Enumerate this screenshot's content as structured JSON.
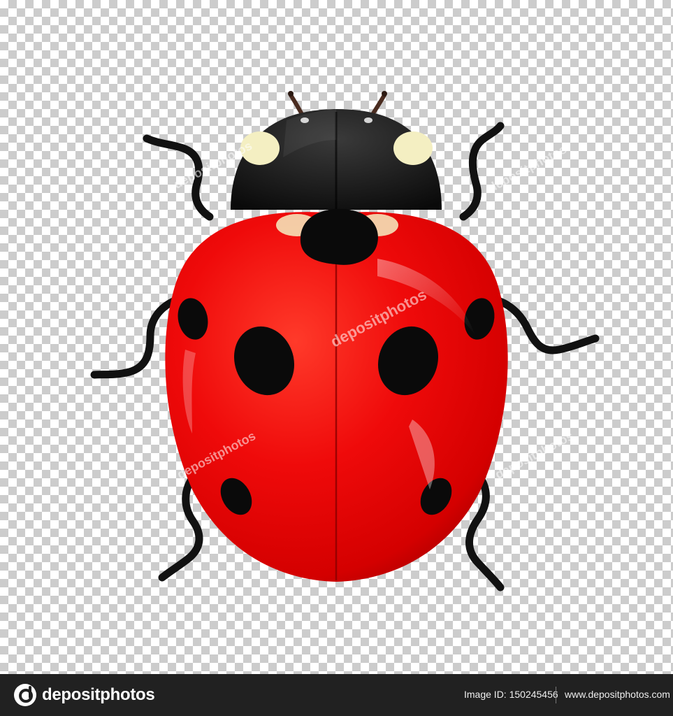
{
  "footer": {
    "logo_text": "depositphotos",
    "image_id": "Image ID: 150245456",
    "site_url": "www.depositphotos.com"
  },
  "colors": {
    "shell_red": "#e8000b",
    "head_black": "#111111",
    "spot_cream": "#f4efc2",
    "footer_bg": "#212121"
  }
}
